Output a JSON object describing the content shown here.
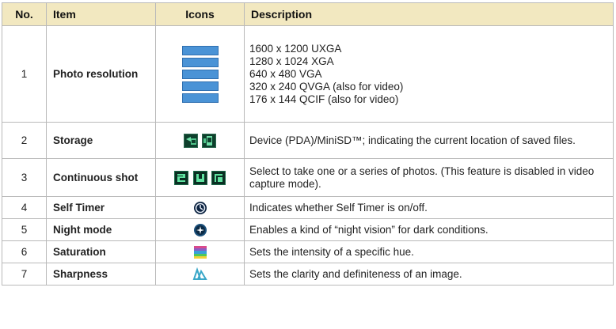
{
  "headers": {
    "no": "No.",
    "item": "Item",
    "icons": "Icons",
    "description": "Description"
  },
  "rows": [
    {
      "no": "1",
      "item": "Photo resolution",
      "desc_lines": [
        "1600 x 1200 UXGA",
        "1280 x 1024 XGA",
        "640 x 480 VGA",
        "320 x 240 QVGA (also for video)",
        "176 x 144 QCIF (also for video)"
      ],
      "icon_names": [
        "res-1600x1200-icon",
        "res-1280x1024-icon",
        "res-640x480-icon",
        "res-320x240-icon",
        "res-176x144-icon"
      ]
    },
    {
      "no": "2",
      "item": "Storage",
      "desc": "Device (PDA)/MiniSD™; indicating the current location of saved files.",
      "icon_names": [
        "storage-minisd-icon",
        "storage-device-icon"
      ]
    },
    {
      "no": "3",
      "item": "Continuous shot",
      "desc": "Select to take one or a series of photos. (This feature is disabled in video capture mode).",
      "icon_names": [
        "continuous-shot-single-icon",
        "continuous-shot-series-icon",
        "continuous-shot-burst-icon"
      ]
    },
    {
      "no": "4",
      "item": "Self Timer",
      "desc": "Indicates whether Self Timer is on/off.",
      "icon_names": [
        "self-timer-icon"
      ]
    },
    {
      "no": "5",
      "item": "Night mode",
      "desc": "Enables a kind of “night vision” for dark conditions.",
      "icon_names": [
        "night-mode-icon"
      ]
    },
    {
      "no": "6",
      "item": "Saturation",
      "desc": "Sets the intensity of a specific hue.",
      "icon_names": [
        "saturation-icon"
      ]
    },
    {
      "no": "7",
      "item": "Sharpness",
      "desc": "Sets the clarity and definiteness of an image.",
      "icon_names": [
        "sharpness-icon"
      ]
    }
  ],
  "colors": {
    "header_bg": "#f2e8c0",
    "border": "#b9b9b9",
    "icon_blue": "#4a93d6"
  }
}
